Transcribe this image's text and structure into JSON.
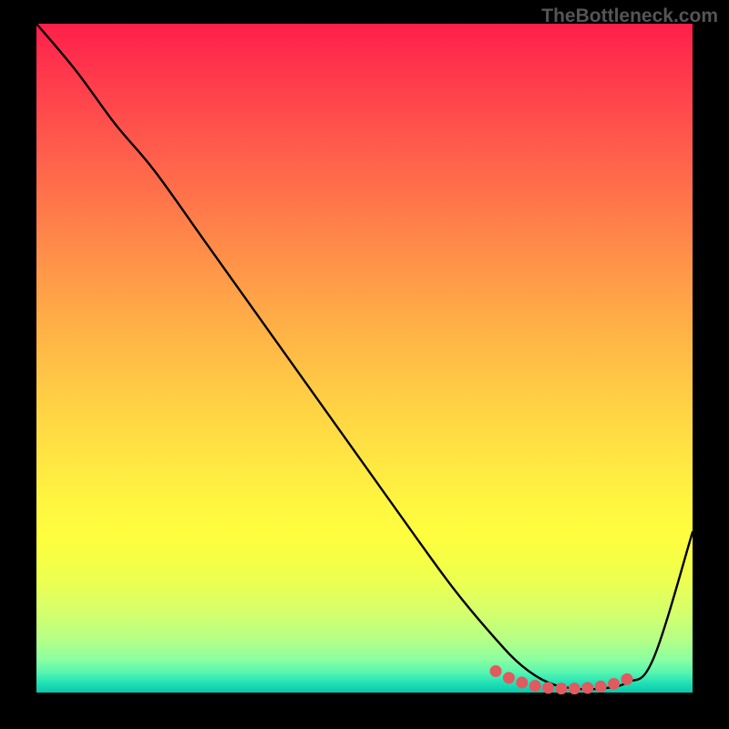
{
  "watermark": "TheBottleneck.com",
  "chart_data": {
    "type": "line",
    "title": "",
    "xlabel": "",
    "ylabel": "",
    "xlim": [
      0,
      100
    ],
    "ylim": [
      0,
      100
    ],
    "grid": false,
    "series": [
      {
        "name": "curve",
        "x": [
          0,
          6,
          12,
          18,
          26,
          34,
          42,
          50,
          58,
          64,
          70,
          74,
          78,
          82,
          86,
          90,
          94,
          100
        ],
        "y": [
          100,
          93,
          85,
          78,
          67,
          56,
          45,
          34,
          23,
          15,
          8,
          4,
          1.5,
          0.6,
          0.6,
          1.5,
          5,
          24
        ]
      }
    ],
    "markers": {
      "name": "bottom-highlight",
      "color": "#e15a5f",
      "x": [
        70,
        72,
        74,
        76,
        78,
        80,
        82,
        84,
        86,
        88,
        90
      ],
      "y": [
        3.2,
        2.2,
        1.5,
        1.0,
        0.7,
        0.6,
        0.6,
        0.7,
        0.9,
        1.3,
        2.0
      ]
    },
    "background_gradient": {
      "top": "#ff1f4a",
      "mid": "#ffd444",
      "bottom": "#05c9ae"
    }
  }
}
